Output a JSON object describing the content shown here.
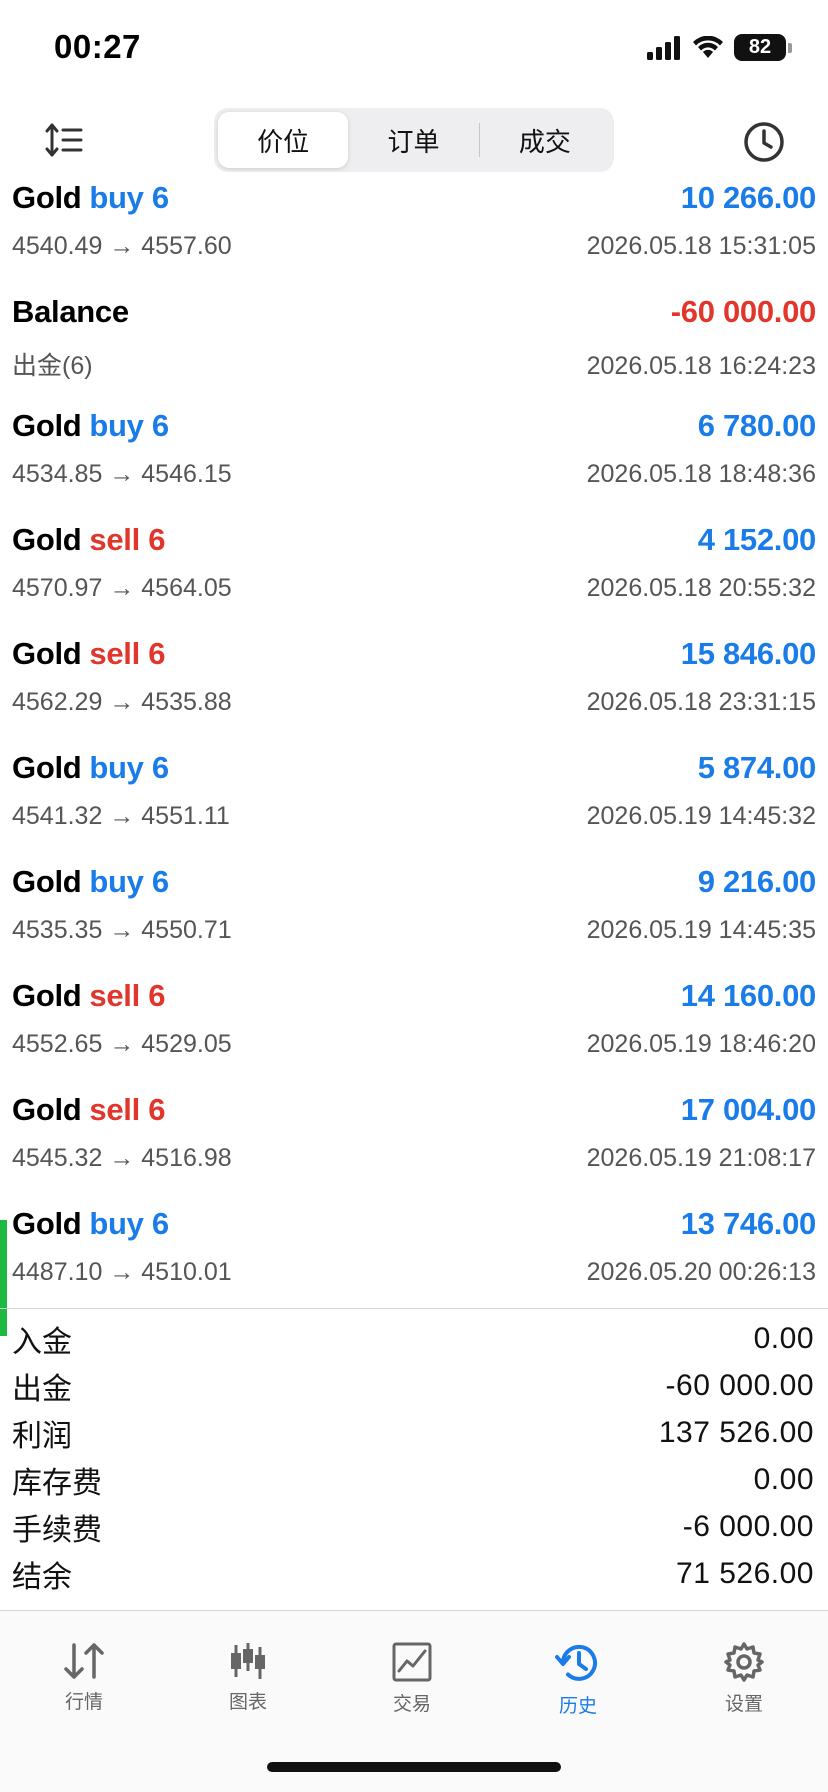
{
  "status_bar": {
    "time": "00:27",
    "battery": "82",
    "icons": [
      "cellular-signal-icon",
      "wifi-icon",
      "battery-icon"
    ]
  },
  "toolbar": {
    "sort_icon": "sort-icon",
    "history_icon": "clock-icon",
    "segments": [
      {
        "label": "价位",
        "active": true
      },
      {
        "label": "订单",
        "active": false
      },
      {
        "label": "成交",
        "active": false
      }
    ]
  },
  "deals": [
    {
      "symbol": "Gold",
      "side": "buy 6",
      "side_type": "buy",
      "profit": "10 266.00",
      "sign": "positive",
      "detail": "4540.49 → 4557.60",
      "time": "2026.05.18 15:31:05"
    },
    {
      "symbol": "Balance",
      "side": "",
      "side_type": "",
      "profit": "-60 000.00",
      "sign": "negative",
      "detail": "出金(6)",
      "time": "2026.05.18 16:24:23"
    },
    {
      "symbol": "Gold",
      "side": "buy 6",
      "side_type": "buy",
      "profit": "6 780.00",
      "sign": "positive",
      "detail": "4534.85 → 4546.15",
      "time": "2026.05.18 18:48:36"
    },
    {
      "symbol": "Gold",
      "side": "sell 6",
      "side_type": "sell",
      "profit": "4 152.00",
      "sign": "positive",
      "detail": "4570.97 → 4564.05",
      "time": "2026.05.18 20:55:32"
    },
    {
      "symbol": "Gold",
      "side": "sell 6",
      "side_type": "sell",
      "profit": "15 846.00",
      "sign": "positive",
      "detail": "4562.29 → 4535.88",
      "time": "2026.05.18 23:31:15"
    },
    {
      "symbol": "Gold",
      "side": "buy 6",
      "side_type": "buy",
      "profit": "5 874.00",
      "sign": "positive",
      "detail": "4541.32 → 4551.11",
      "time": "2026.05.19 14:45:32"
    },
    {
      "symbol": "Gold",
      "side": "buy 6",
      "side_type": "buy",
      "profit": "9 216.00",
      "sign": "positive",
      "detail": "4535.35 → 4550.71",
      "time": "2026.05.19 14:45:35"
    },
    {
      "symbol": "Gold",
      "side": "sell 6",
      "side_type": "sell",
      "profit": "14 160.00",
      "sign": "positive",
      "detail": "4552.65 → 4529.05",
      "time": "2026.05.19 18:46:20"
    },
    {
      "symbol": "Gold",
      "side": "sell 6",
      "side_type": "sell",
      "profit": "17 004.00",
      "sign": "positive",
      "detail": "4545.32 → 4516.98",
      "time": "2026.05.19 21:08:17"
    },
    {
      "symbol": "Gold",
      "side": "buy 6",
      "side_type": "buy",
      "profit": "13 746.00",
      "sign": "positive",
      "detail": "4487.10 → 4510.01",
      "time": "2026.05.20 00:26:13",
      "highlight": true
    }
  ],
  "summary": [
    {
      "label": "入金",
      "value": "0.00"
    },
    {
      "label": "出金",
      "value": "-60 000.00"
    },
    {
      "label": "利润",
      "value": "137 526.00"
    },
    {
      "label": "库存费",
      "value": "0.00"
    },
    {
      "label": "手续费",
      "value": "-6 000.00"
    },
    {
      "label": "结余",
      "value": "71 526.00"
    }
  ],
  "tabs": [
    {
      "label": "行情",
      "icon": "quotes-arrows-icon",
      "active": false
    },
    {
      "label": "图表",
      "icon": "candlestick-chart-icon",
      "active": false
    },
    {
      "label": "交易",
      "icon": "trade-chart-icon",
      "active": false
    },
    {
      "label": "历史",
      "icon": "history-clock-icon",
      "active": true
    },
    {
      "label": "设置",
      "icon": "gear-icon",
      "active": false
    }
  ],
  "colors": {
    "accent_blue": "#1a7ce8",
    "sell_red": "#e0362c",
    "highlight_green": "#1db941"
  }
}
